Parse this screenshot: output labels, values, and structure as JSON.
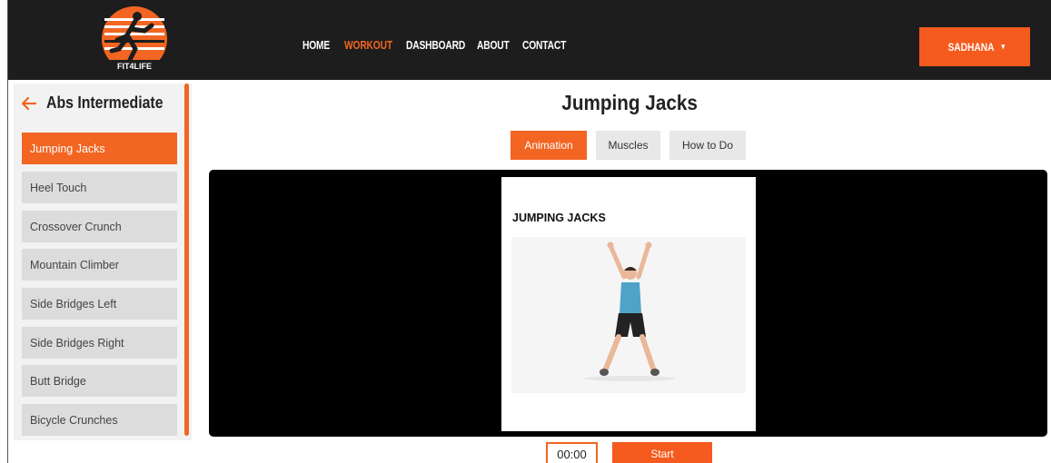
{
  "brand": {
    "logo_text": "FIT4LIFE"
  },
  "nav": {
    "links": [
      {
        "label": "HOME",
        "active": false
      },
      {
        "label": "WORKOUT",
        "active": true
      },
      {
        "label": "DASHBOARD",
        "active": false
      },
      {
        "label": "ABOUT",
        "active": false
      },
      {
        "label": "CONTACT",
        "active": false
      }
    ],
    "user_label": "SADHANA",
    "user_caret": "▾"
  },
  "sidebar": {
    "title": "Abs Intermediate",
    "back_icon": "arrow-left-icon",
    "items": [
      {
        "label": "Jumping Jacks",
        "active": true
      },
      {
        "label": "Heel Touch",
        "active": false
      },
      {
        "label": "Crossover Crunch",
        "active": false
      },
      {
        "label": "Mountain Climber",
        "active": false
      },
      {
        "label": "Side Bridges Left",
        "active": false
      },
      {
        "label": "Side Bridges Right",
        "active": false
      },
      {
        "label": "Butt Bridge",
        "active": false
      },
      {
        "label": "Bicycle Crunches",
        "active": false
      }
    ]
  },
  "main": {
    "title": "Jumping Jacks",
    "tabs": [
      {
        "label": "Animation",
        "active": true
      },
      {
        "label": "Muscles",
        "active": false
      },
      {
        "label": "How to Do",
        "active": false
      }
    ],
    "card_title": "JUMPING JACKS",
    "timer": "00:00",
    "start_label": "Start"
  },
  "colors": {
    "accent": "#f26522",
    "navbar": "#1d1d1d",
    "player_bg": "#000000"
  }
}
